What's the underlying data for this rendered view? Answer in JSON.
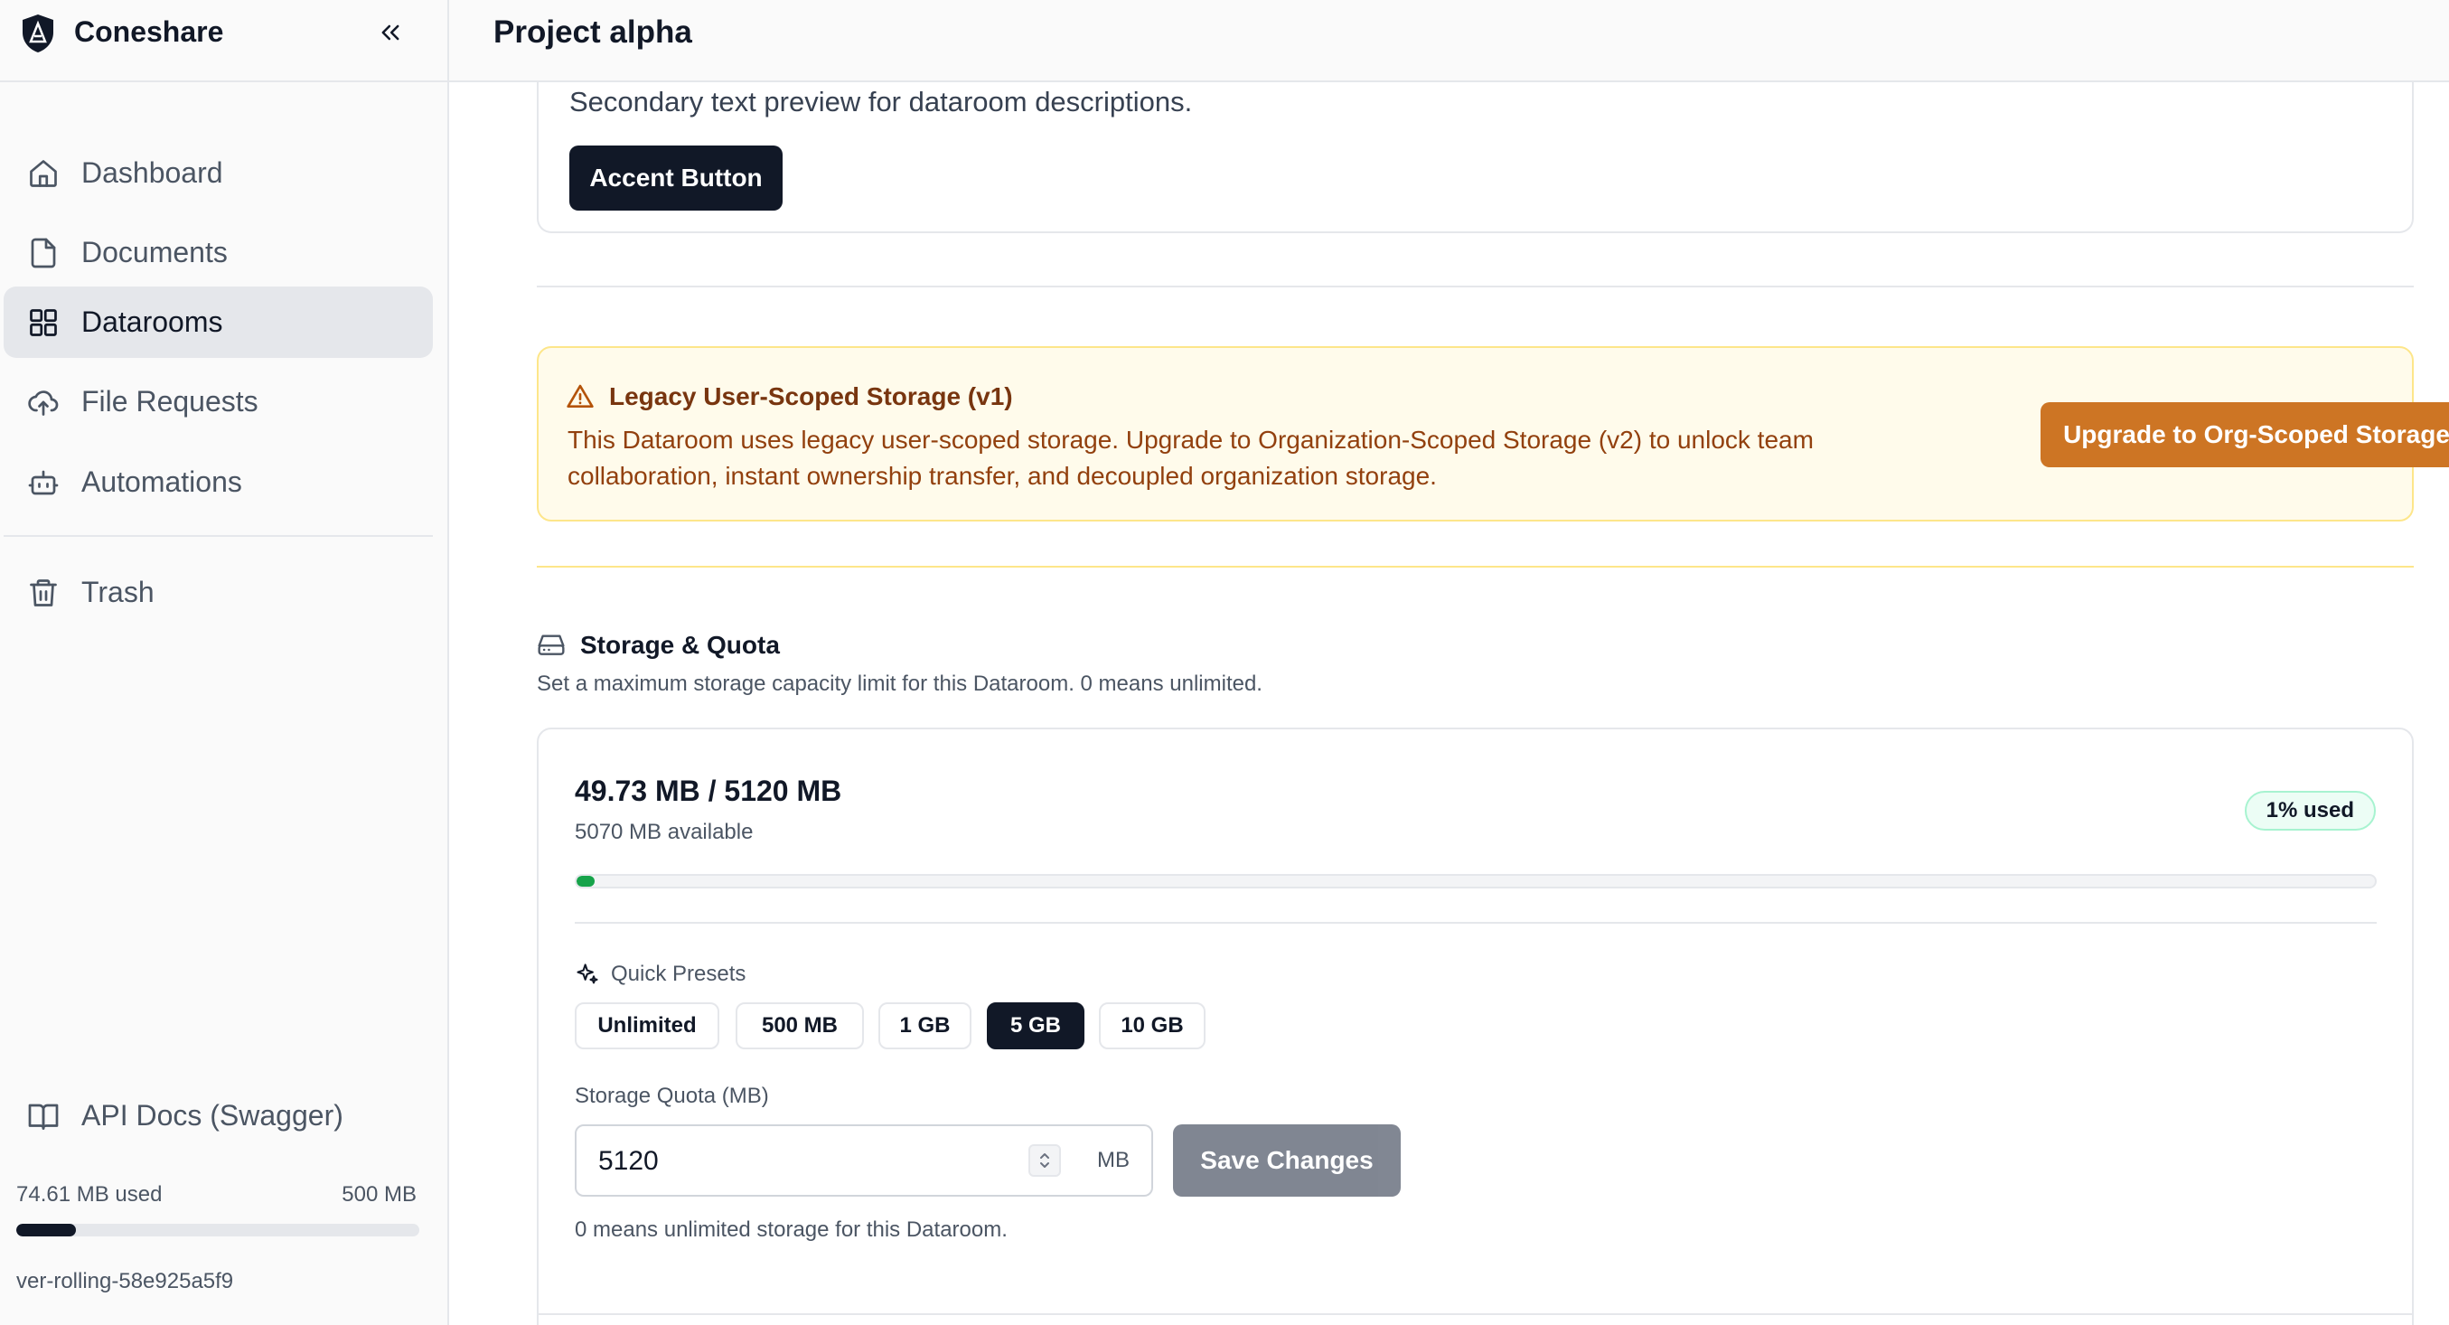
{
  "app": {
    "name": "Coneshare"
  },
  "header": {
    "title": "Project alpha"
  },
  "sidebar": {
    "items": [
      {
        "label": "Dashboard",
        "icon": "home-icon",
        "active": false
      },
      {
        "label": "Documents",
        "icon": "document-icon",
        "active": false
      },
      {
        "label": "Datarooms",
        "icon": "grid-icon",
        "active": true
      },
      {
        "label": "File Requests",
        "icon": "cloud-upload-icon",
        "active": false
      },
      {
        "label": "Automations",
        "icon": "bot-icon",
        "active": false
      }
    ],
    "trash": {
      "label": "Trash",
      "icon": "trash-icon"
    },
    "api_docs": {
      "label": "API Docs (Swagger)",
      "icon": "book-icon"
    },
    "usage": {
      "used": "74.61 MB used",
      "total": "500 MB",
      "fraction": 0.149
    },
    "version": "ver-rolling-58e925a5f9"
  },
  "theme_preview": {
    "text": "Secondary text preview for dataroom descriptions.",
    "button_label": "Accent Button"
  },
  "legacy_warning": {
    "title": "Legacy User-Scoped Storage (v1)",
    "body": "This Dataroom uses legacy user-scoped storage. Upgrade to Organization-Scoped Storage (v2) to unlock team collaboration, instant ownership transfer, and decoupled organization storage.",
    "button_label": "Upgrade to Org-Scoped Storage"
  },
  "storage": {
    "title": "Storage & Quota",
    "subtitle": "Set a maximum storage capacity limit for this Dataroom. 0 means unlimited.",
    "usage_text": "49.73 MB / 5120 MB",
    "available_text": "5070 MB available",
    "used_badge": "1% used",
    "used_fraction": 0.0097,
    "presets_label": "Quick Presets",
    "presets": [
      {
        "label": "Unlimited",
        "selected": false
      },
      {
        "label": "500 MB",
        "selected": false
      },
      {
        "label": "1 GB",
        "selected": false
      },
      {
        "label": "5 GB",
        "selected": true
      },
      {
        "label": "10 GB",
        "selected": false
      }
    ],
    "quota_label": "Storage Quota (MB)",
    "quota_value": "5120",
    "quota_unit": "MB",
    "save_label": "Save Changes",
    "hint": "0 means unlimited storage for this Dataroom."
  },
  "colors": {
    "accent": "#111827",
    "warning_bg": "#fffbeb",
    "warning_border": "#fde68a",
    "upgrade_button": "#cd7524",
    "progress_fill": "#16a34a"
  }
}
